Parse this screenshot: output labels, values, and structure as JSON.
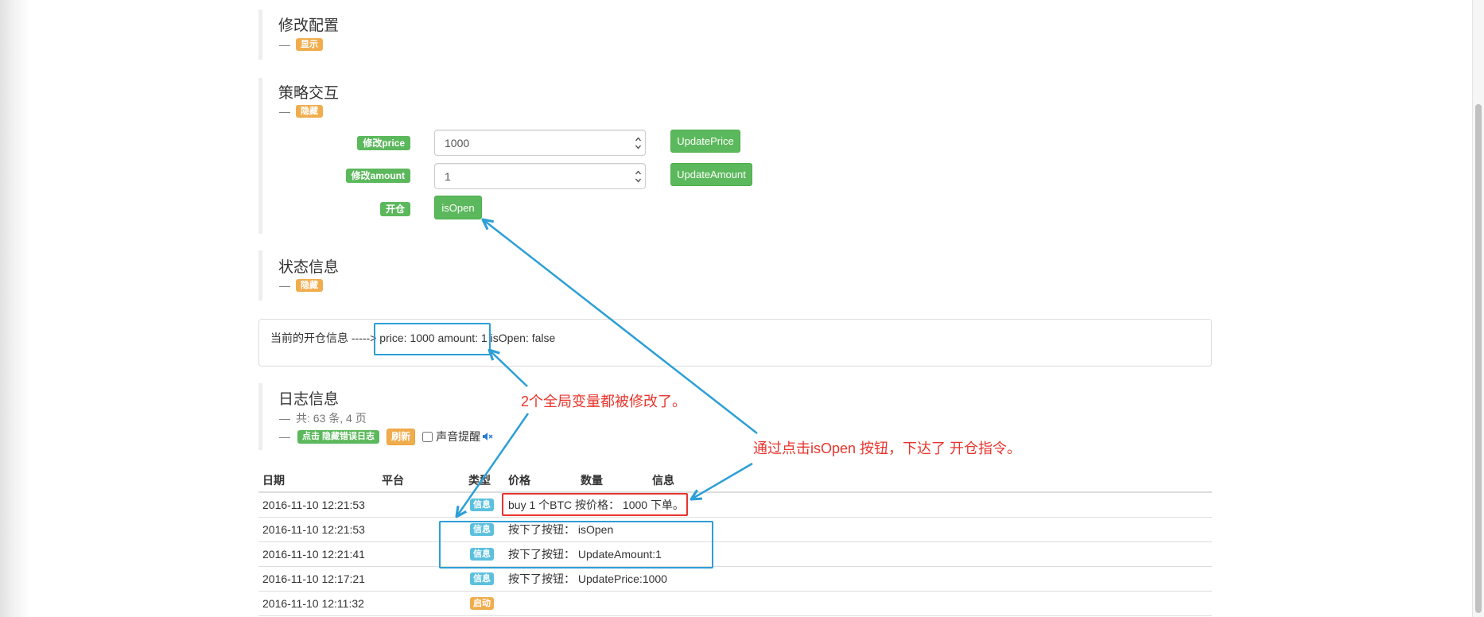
{
  "colors": {
    "warning": "#f0ad4e",
    "success": "#5cb85c",
    "info": "#5bc0de",
    "annotation_blue": "#2c9fd6",
    "annotation_red": "#e8352d"
  },
  "config": {
    "title": "修改配置",
    "dash": "—",
    "toggle": "显示"
  },
  "interaction": {
    "title": "策略交互",
    "dash": "—",
    "toggle": "隐藏",
    "price": {
      "label": "修改price",
      "value": "1000",
      "button": "UpdatePrice"
    },
    "amount": {
      "label": "修改amount",
      "value": "1",
      "button": "UpdateAmount"
    },
    "open": {
      "label": "开仓",
      "button": "isOpen"
    }
  },
  "status": {
    "title": "状态信息",
    "dash": "—",
    "toggle": "隐藏",
    "message_prefix": "当前的开仓信息 ----->",
    "message_highlight": "price: 1000 amount: 1",
    "message_suffix": "isOpen: false"
  },
  "log": {
    "title": "日志信息",
    "dash": "—",
    "summary": "共: 63 条, 4 页",
    "hide_errors": "点击 隐藏错误日志",
    "refresh": "刷新",
    "sound_label": "声音提醒",
    "sound_checked": false,
    "sound_icon": "speaker-muted-icon",
    "columns": [
      "日期",
      "平台",
      "类型",
      "价格",
      "数量",
      "信息"
    ],
    "rows": [
      {
        "date": "2016-11-10 12:21:53",
        "type": "信息",
        "message": "buy 1 个BTC 按价格： 1000 下单。"
      },
      {
        "date": "2016-11-10 12:21:53",
        "type": "信息",
        "message": "按下了按钮： isOpen"
      },
      {
        "date": "2016-11-10 12:21:41",
        "type": "信息",
        "message": "按下了按钮： UpdateAmount:1"
      },
      {
        "date": "2016-11-10 12:17:21",
        "type": "信息",
        "message": "按下了按钮： UpdatePrice:1000"
      },
      {
        "date": "2016-11-10 12:11:32",
        "type": "启动"
      }
    ]
  },
  "annotations": {
    "variables_note": "2个全局变量都被修改了。",
    "isopen_note": "通过点击isOpen 按钮，下达了 开仓指令。"
  }
}
